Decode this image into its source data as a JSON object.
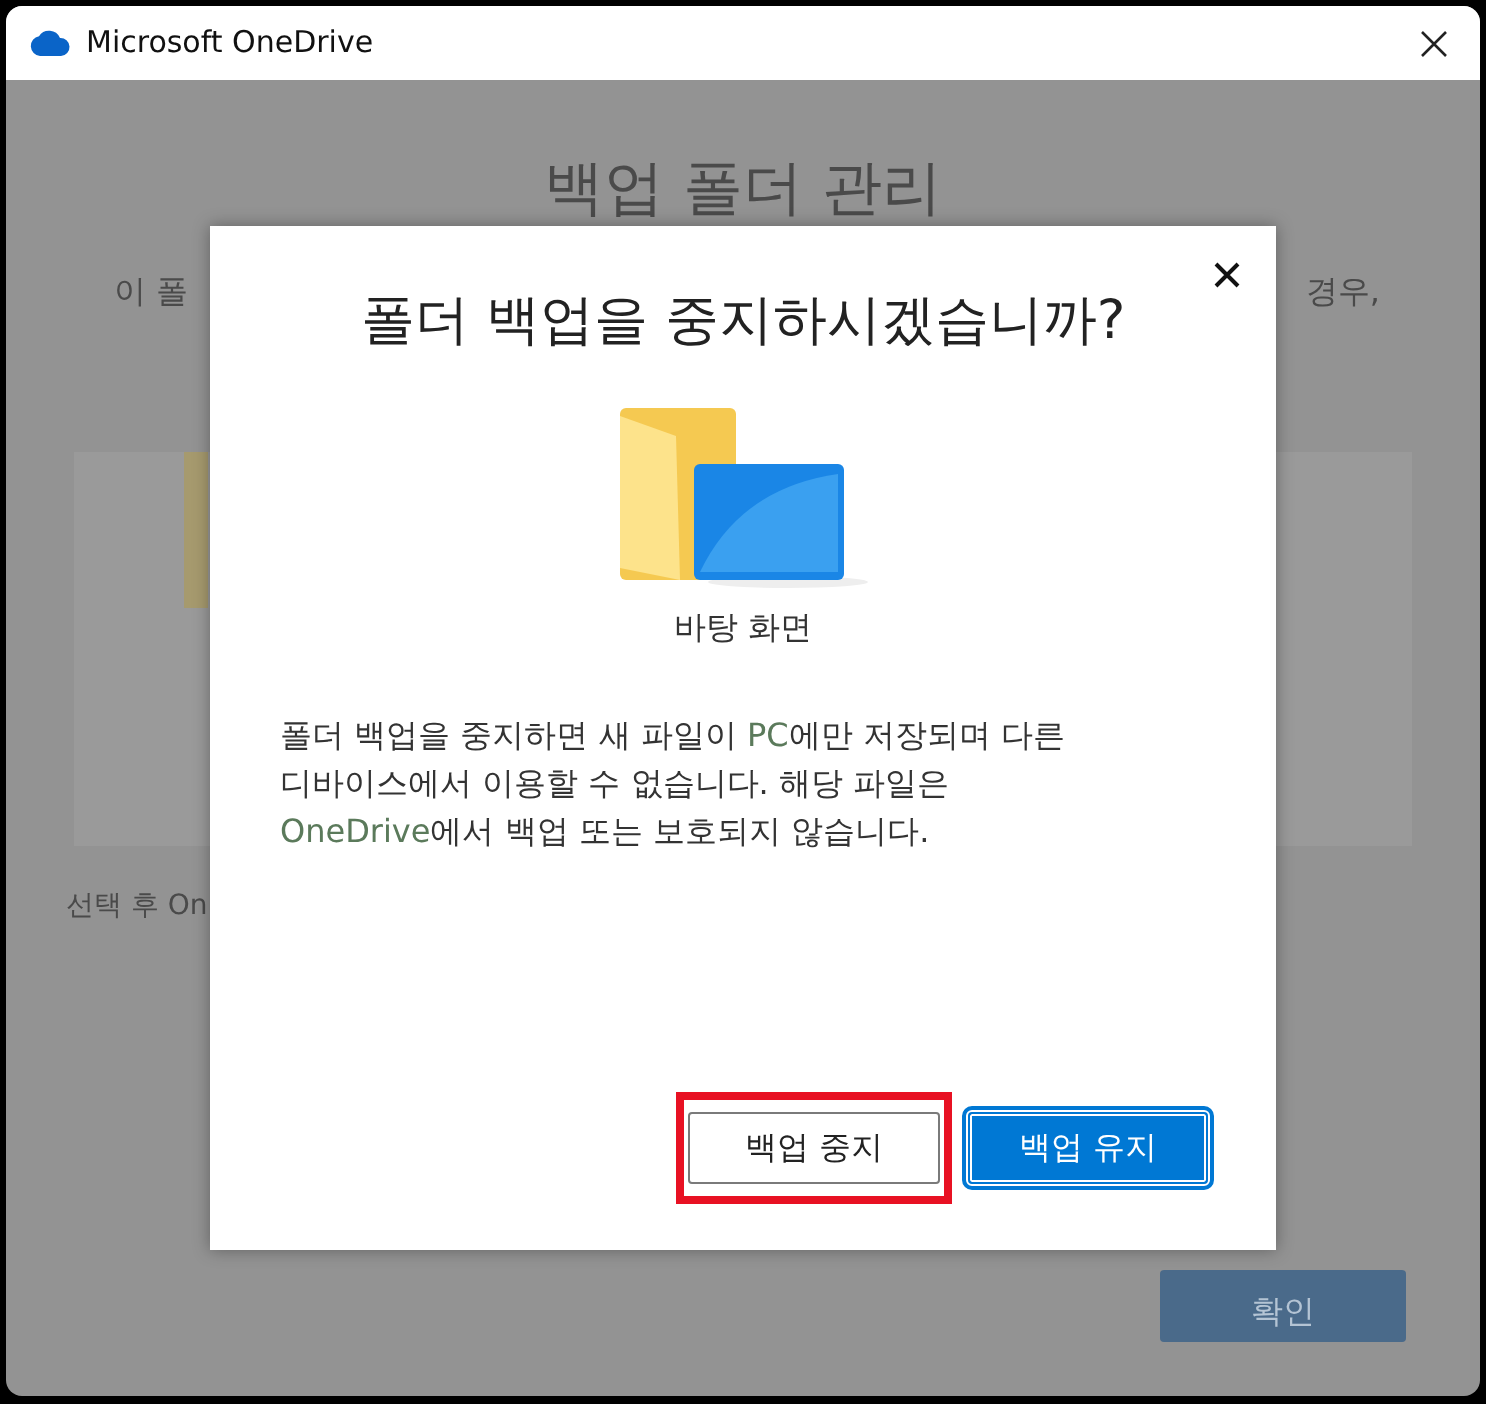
{
  "window": {
    "title": "Microsoft OneDrive"
  },
  "background": {
    "heading": "백업 폴더 관리",
    "description_left": "이 폴",
    "description_right": "경우,",
    "note": "선택 후 On",
    "confirm_button": "확인"
  },
  "dialog": {
    "title": "폴더 백업을 중지하시겠습니까?",
    "folder_label": "바탕 화면",
    "message": [
      {
        "text": "폴더 백업을 중지하면 새 파일이 ",
        "accent": false
      },
      {
        "text": "PC",
        "accent": true
      },
      {
        "text": "에만 저장되며 다른 디바이스에서 이용할 수 없습니다. 해당 파일은 ",
        "accent": false
      },
      {
        "text": "OneDrive",
        "accent": true
      },
      {
        "text": "에서 백업 또는 보호되지 않습니다.",
        "accent": false
      }
    ],
    "buttons": [
      {
        "label": "백업 중지",
        "kind": "secondary",
        "highlighted": true
      },
      {
        "label": "백업 유지",
        "kind": "primary",
        "highlighted": false
      }
    ]
  }
}
